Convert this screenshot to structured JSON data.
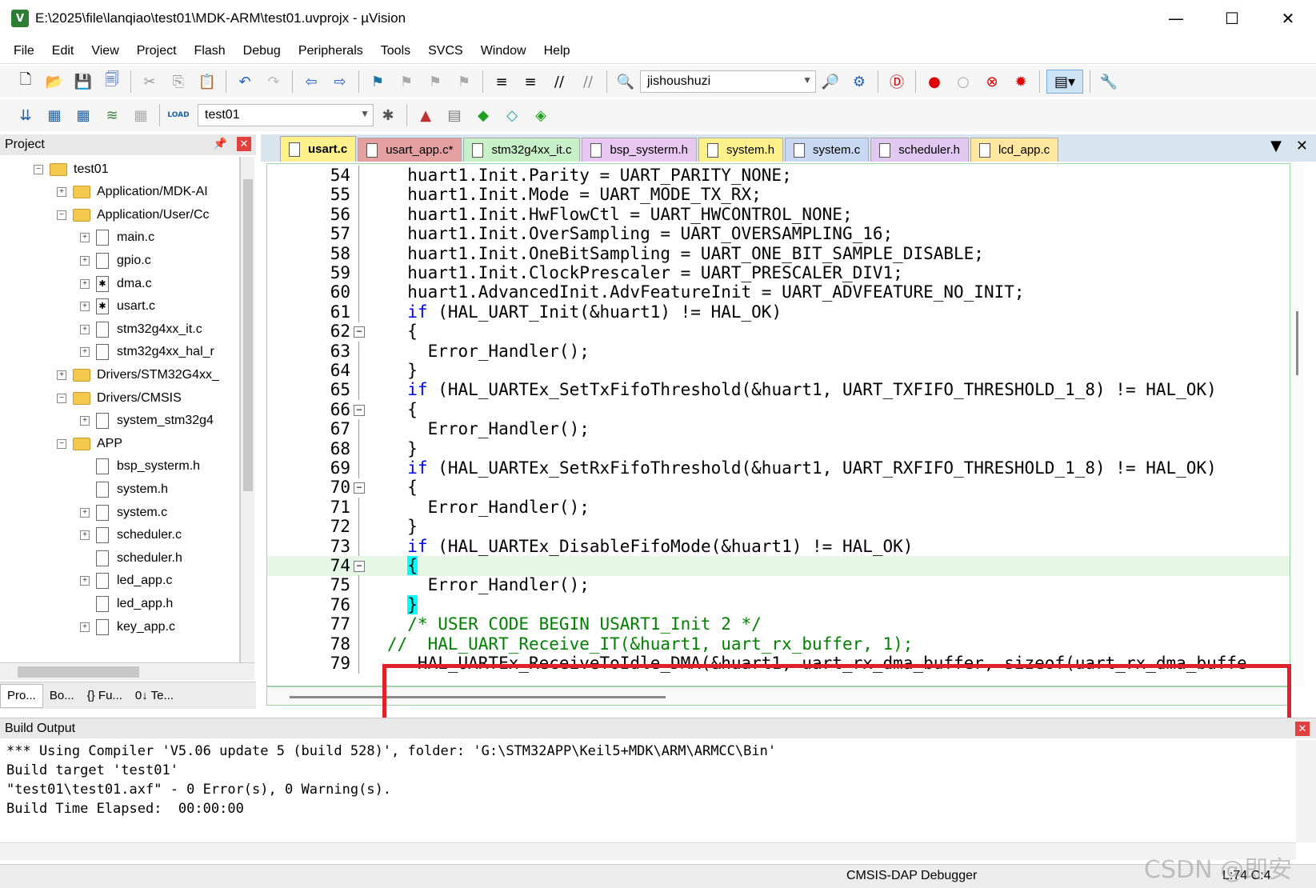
{
  "window": {
    "title": "E:\\2025\\file\\lanqiao\\test01\\MDK-ARM\\test01.uvprojx - µVision",
    "app_icon_label": "V",
    "minimize_glyph": "—",
    "maximize_glyph": "☐",
    "close_glyph": "✕"
  },
  "menu": [
    "File",
    "Edit",
    "View",
    "Project",
    "Flash",
    "Debug",
    "Peripherals",
    "Tools",
    "SVCS",
    "Window",
    "Help"
  ],
  "toolbar": {
    "find_combo_value": "jishoushuzi",
    "target_combo_value": "test01",
    "load_label": "LOAD"
  },
  "project_panel": {
    "title": "Project",
    "tree": [
      {
        "label": "test01",
        "kind": "root",
        "exp": "−"
      },
      {
        "label": "Application/MDK-AI",
        "kind": "folder",
        "exp": "+"
      },
      {
        "label": "Application/User/Cc",
        "kind": "folder",
        "exp": "−"
      },
      {
        "label": "main.c",
        "kind": "file",
        "exp": "+"
      },
      {
        "label": "gpio.c",
        "kind": "file",
        "exp": "+"
      },
      {
        "label": "dma.c",
        "kind": "gear",
        "exp": "+"
      },
      {
        "label": "usart.c",
        "kind": "gear",
        "exp": "+"
      },
      {
        "label": "stm32g4xx_it.c",
        "kind": "file",
        "exp": "+"
      },
      {
        "label": "stm32g4xx_hal_r",
        "kind": "file",
        "exp": "+"
      },
      {
        "label": "Drivers/STM32G4xx_",
        "kind": "folder",
        "exp": "+"
      },
      {
        "label": "Drivers/CMSIS",
        "kind": "folder",
        "exp": "−"
      },
      {
        "label": "system_stm32g4",
        "kind": "file",
        "exp": "+"
      },
      {
        "label": "APP",
        "kind": "folder",
        "exp": "−"
      },
      {
        "label": "bsp_systerm.h",
        "kind": "file",
        "exp": ""
      },
      {
        "label": "system.h",
        "kind": "file",
        "exp": ""
      },
      {
        "label": "system.c",
        "kind": "file",
        "exp": "+"
      },
      {
        "label": "scheduler.c",
        "kind": "file",
        "exp": "+"
      },
      {
        "label": "scheduler.h",
        "kind": "file",
        "exp": ""
      },
      {
        "label": "led_app.c",
        "kind": "file",
        "exp": "+"
      },
      {
        "label": "led_app.h",
        "kind": "file",
        "exp": ""
      },
      {
        "label": "key_app.c",
        "kind": "file",
        "exp": "+"
      }
    ],
    "bottom_tabs": [
      "Pro...",
      "Bo...",
      "{} Fu...",
      "0↓ Te..."
    ]
  },
  "editor": {
    "tabs": [
      {
        "label": "usart.c",
        "color": "#fef08a",
        "active": true
      },
      {
        "label": "usart_app.c*",
        "color": "#e4a0a0",
        "active": false
      },
      {
        "label": "stm32g4xx_it.c",
        "color": "#c8f0c8",
        "active": false
      },
      {
        "label": "bsp_systerm.h",
        "color": "#e8c8f0",
        "active": false
      },
      {
        "label": "system.h",
        "color": "#fef08a",
        "active": false
      },
      {
        "label": "system.c",
        "color": "#c8d8f0",
        "active": false
      },
      {
        "label": "scheduler.h",
        "color": "#e0c8f0",
        "active": false
      },
      {
        "label": "lcd_app.c",
        "color": "#fde7a0",
        "active": false
      }
    ],
    "tab_menu_glyph": "▼",
    "tab_close_glyph": "✕",
    "lines": [
      {
        "n": "54",
        "code": "  huart1.Init.Parity = UART_PARITY_NONE;"
      },
      {
        "n": "55",
        "code": "  huart1.Init.Mode = UART_MODE_TX_RX;"
      },
      {
        "n": "56",
        "code": "  huart1.Init.HwFlowCtl = UART_HWCONTROL_NONE;"
      },
      {
        "n": "57",
        "code": "  huart1.Init.OverSampling = UART_OVERSAMPLING_16;"
      },
      {
        "n": "58",
        "code": "  huart1.Init.OneBitSampling = UART_ONE_BIT_SAMPLE_DISABLE;"
      },
      {
        "n": "59",
        "code": "  huart1.Init.ClockPrescaler = UART_PRESCALER_DIV1;"
      },
      {
        "n": "60",
        "code": "  huart1.AdvancedInit.AdvFeatureInit = UART_ADVFEATURE_NO_INIT;"
      },
      {
        "n": "61",
        "kw": "  if",
        "code": " (HAL_UART_Init(&huart1) != HAL_OK)"
      },
      {
        "n": "62",
        "code": "  {",
        "fold": "−"
      },
      {
        "n": "63",
        "code": "    Error_Handler();"
      },
      {
        "n": "64",
        "code": "  }"
      },
      {
        "n": "65",
        "kw": "  if",
        "code": " (HAL_UARTEx_SetTxFifoThreshold(&huart1, UART_TXFIFO_THRESHOLD_1_8) != HAL_OK)"
      },
      {
        "n": "66",
        "code": "  {",
        "fold": "−"
      },
      {
        "n": "67",
        "code": "    Error_Handler();"
      },
      {
        "n": "68",
        "code": "  }"
      },
      {
        "n": "69",
        "kw": "  if",
        "code": " (HAL_UARTEx_SetRxFifoThreshold(&huart1, UART_RXFIFO_THRESHOLD_1_8) != HAL_OK)"
      },
      {
        "n": "70",
        "code": "  {",
        "fold": "−"
      },
      {
        "n": "71",
        "code": "    Error_Handler();"
      },
      {
        "n": "72",
        "code": "  }"
      },
      {
        "n": "73",
        "kw": "  if",
        "code": " (HAL_UARTEx_DisableFifoMode(&huart1) != HAL_OK)"
      },
      {
        "n": "74",
        "code": "  {",
        "fold": "−",
        "current": true,
        "brace": true
      },
      {
        "n": "75",
        "code": "    Error_Handler();"
      },
      {
        "n": "76",
        "code": "  }",
        "brace": true
      },
      {
        "n": "77",
        "comment": "  /* USER CODE BEGIN USART1_Init 2 */"
      },
      {
        "n": "78",
        "comment": "//  HAL_UART_Receive_IT(&huart1, uart_rx_buffer, 1);"
      },
      {
        "n": "79",
        "code": "   HAL_UARTEx_ReceiveToIdle_DMA(&huart1, uart_rx_dma_buffer, sizeof(uart_rx_dma_buffe"
      }
    ]
  },
  "build_output": {
    "title": "Build Output",
    "lines": [
      "*** Using Compiler 'V5.06 update 5 (build 528)', folder: 'G:\\STM32APP\\Keil5+MDK\\ARM\\ARMCC\\Bin'",
      "Build target 'test01'",
      "\"test01\\test01.axf\" - 0 Error(s), 0 Warning(s).",
      "Build Time Elapsed:  00:00:00"
    ]
  },
  "statusbar": {
    "debugger": "CMSIS-DAP Debugger",
    "position": "L:74 C:4"
  },
  "watermark": "CSDN @即安莉"
}
